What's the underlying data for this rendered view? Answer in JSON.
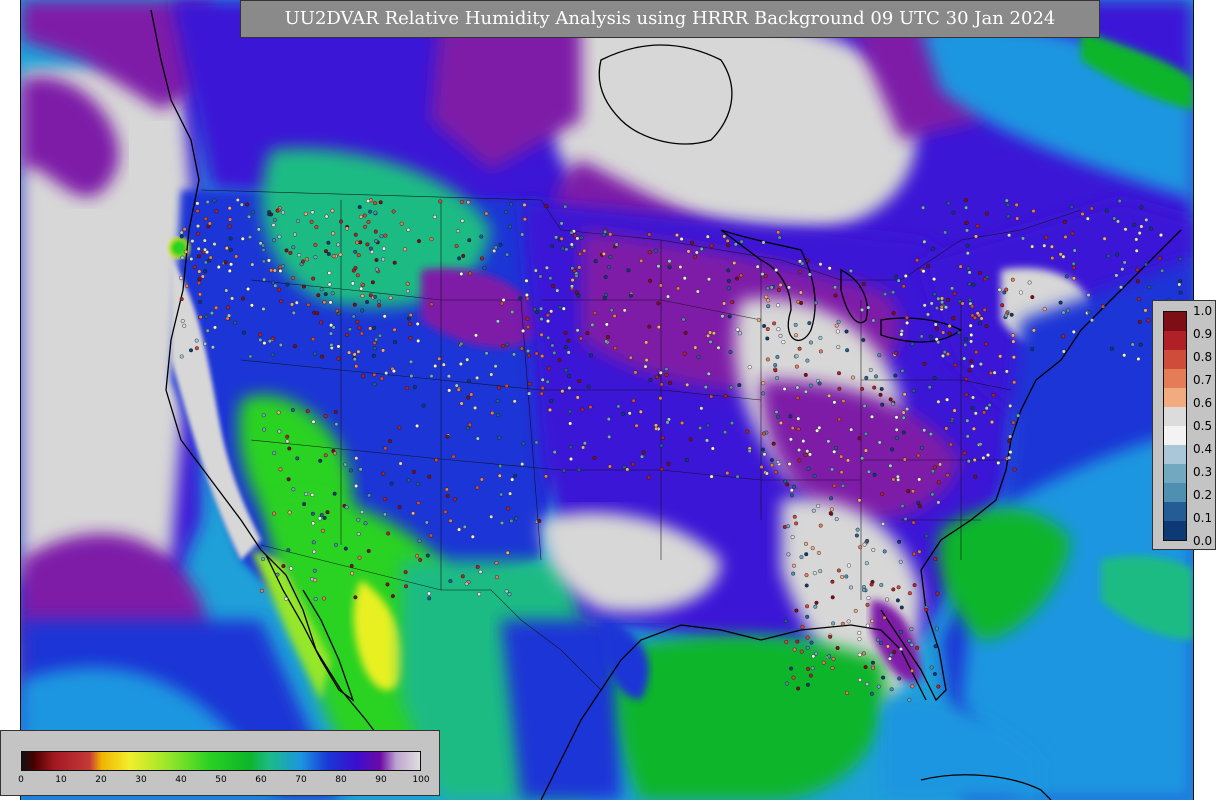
{
  "title": "UU2DVAR Relative Humidity Analysis using HRRR Background 09 UTC 30 Jan 2024",
  "colors": {
    "title_bg": "#8a8a8a",
    "panel_bg": "#c4c4c4",
    "ocean": "#1fa0d8",
    "moist": "#3a16d6",
    "saturated": "#7e1aa8",
    "clear": "#d7d7d7",
    "dry": "#2fd21f",
    "very_dry": "#e8f020"
  },
  "rh_colorbar": {
    "ticks": [
      "0",
      "10",
      "20",
      "30",
      "40",
      "50",
      "60",
      "70",
      "80",
      "90",
      "100"
    ],
    "stops": [
      {
        "v": 0,
        "c": "#111111"
      },
      {
        "v": 3,
        "c": "#4a0000"
      },
      {
        "v": 8,
        "c": "#a0181f"
      },
      {
        "v": 17,
        "c": "#c73a3a"
      },
      {
        "v": 20,
        "c": "#f0b400"
      },
      {
        "v": 27,
        "c": "#f2ee2c"
      },
      {
        "v": 37,
        "c": "#96e62a"
      },
      {
        "v": 47,
        "c": "#2bd223"
      },
      {
        "v": 57,
        "c": "#0db52a"
      },
      {
        "v": 62,
        "c": "#1bbb84"
      },
      {
        "v": 70,
        "c": "#1c96e0"
      },
      {
        "v": 77,
        "c": "#1a36d6"
      },
      {
        "v": 84,
        "c": "#3c0ecf"
      },
      {
        "v": 90,
        "c": "#6b0aa6"
      },
      {
        "v": 94,
        "c": "#bda3cf"
      },
      {
        "v": 100,
        "c": "#e0e0e0"
      }
    ]
  },
  "obs_colorbar": {
    "ticks": [
      "1.0",
      "0.9",
      "0.8",
      "0.7",
      "0.6",
      "0.5",
      "0.4",
      "0.3",
      "0.2",
      "0.1",
      "0.0"
    ],
    "colors": [
      "#7e0e16",
      "#b02026",
      "#cf4b3a",
      "#e57c58",
      "#f2ab7e",
      "#dcdcdc",
      "#f3f3f3",
      "#a9c7d8",
      "#72a9c0",
      "#4f90b0",
      "#245d95",
      "#0d3974"
    ]
  }
}
